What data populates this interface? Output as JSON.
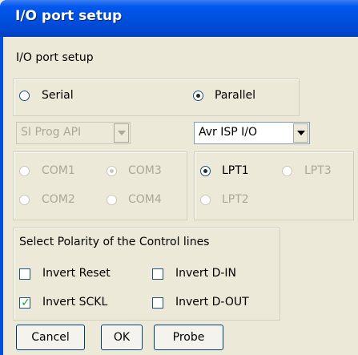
{
  "window": {
    "title": "I/O port setup"
  },
  "header_label": "I/O port setup",
  "connection": {
    "serial_label": "Serial",
    "parallel_label": "Parallel",
    "selected": "Parallel"
  },
  "serial": {
    "api_select": "SI Prog API",
    "ports": [
      {
        "label": "COM1",
        "selected": false
      },
      {
        "label": "COM3",
        "selected": true
      },
      {
        "label": "COM2",
        "selected": false
      },
      {
        "label": "COM4",
        "selected": false
      }
    ]
  },
  "parallel": {
    "driver_select": "Avr ISP I/O",
    "ports": [
      {
        "label": "LPT1",
        "selected": true
      },
      {
        "label": "LPT3",
        "selected": false
      },
      {
        "label": "LPT2",
        "selected": false
      }
    ]
  },
  "polarity": {
    "title": "Select Polarity of the Control lines",
    "invert_reset": {
      "label": "Invert Reset",
      "checked": false
    },
    "invert_din": {
      "label": "Invert D-IN",
      "checked": false
    },
    "invert_sckl": {
      "label": "Invert SCKL",
      "checked": true
    },
    "invert_dout": {
      "label": "Invert D-OUT",
      "checked": false
    }
  },
  "buttons": {
    "cancel": "Cancel",
    "ok": "OK",
    "probe": "Probe"
  },
  "colors": {
    "titlebar": "#0054e3",
    "face": "#ece9d8",
    "radio_dot": "#21a121",
    "disabled_text": "#aca899"
  }
}
